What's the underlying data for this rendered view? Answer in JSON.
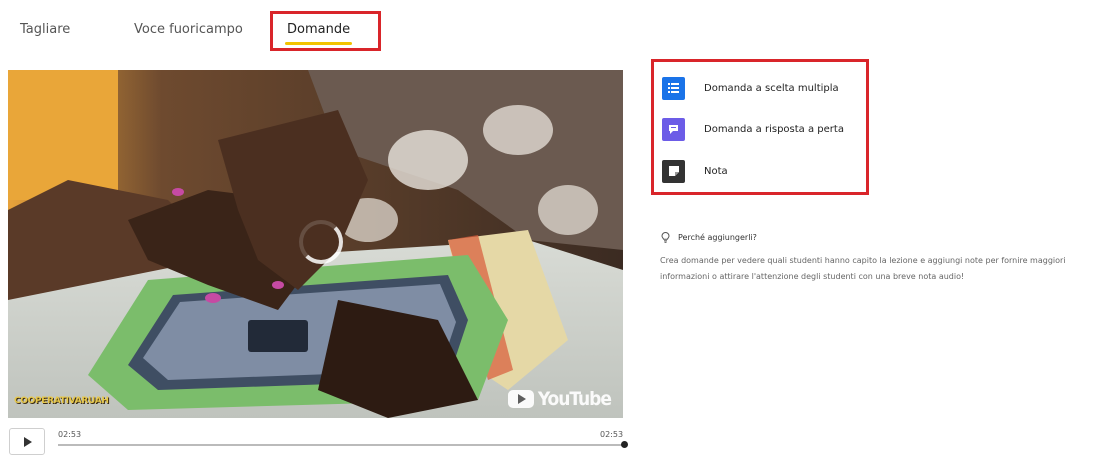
{
  "tabs": [
    {
      "label": "Tagliare"
    },
    {
      "label": "Voce fuoricampo"
    },
    {
      "label": "Domande"
    }
  ],
  "active_tab_underline_color": "#f2c300",
  "highlight_color": "#d9252a",
  "video": {
    "watermark": "COOPERATIVARUAH",
    "platform": "YouTube",
    "loading_icon": "spinner-icon"
  },
  "player": {
    "current_time": "02:53",
    "duration": "02:53",
    "progress_fraction": 1.0,
    "play_icon": "play-icon"
  },
  "question_types": [
    {
      "label": "Domanda a scelta multipla",
      "icon": "list-icon",
      "color": "#1a73e8"
    },
    {
      "label": "Domanda a risposta a perta",
      "icon": "comment-icon",
      "color": "#6c5ce7"
    },
    {
      "label": "Nota",
      "icon": "note-icon",
      "color": "#333333"
    }
  ],
  "info": {
    "title": "Perché aggiungerli?",
    "icon": "lightbulb-icon",
    "text": "Crea domande per vedere quali studenti hanno capito la lezione e aggiungi note per fornire maggiori informazioni o attirare l'attenzione degli studenti con una breve nota audio!"
  }
}
